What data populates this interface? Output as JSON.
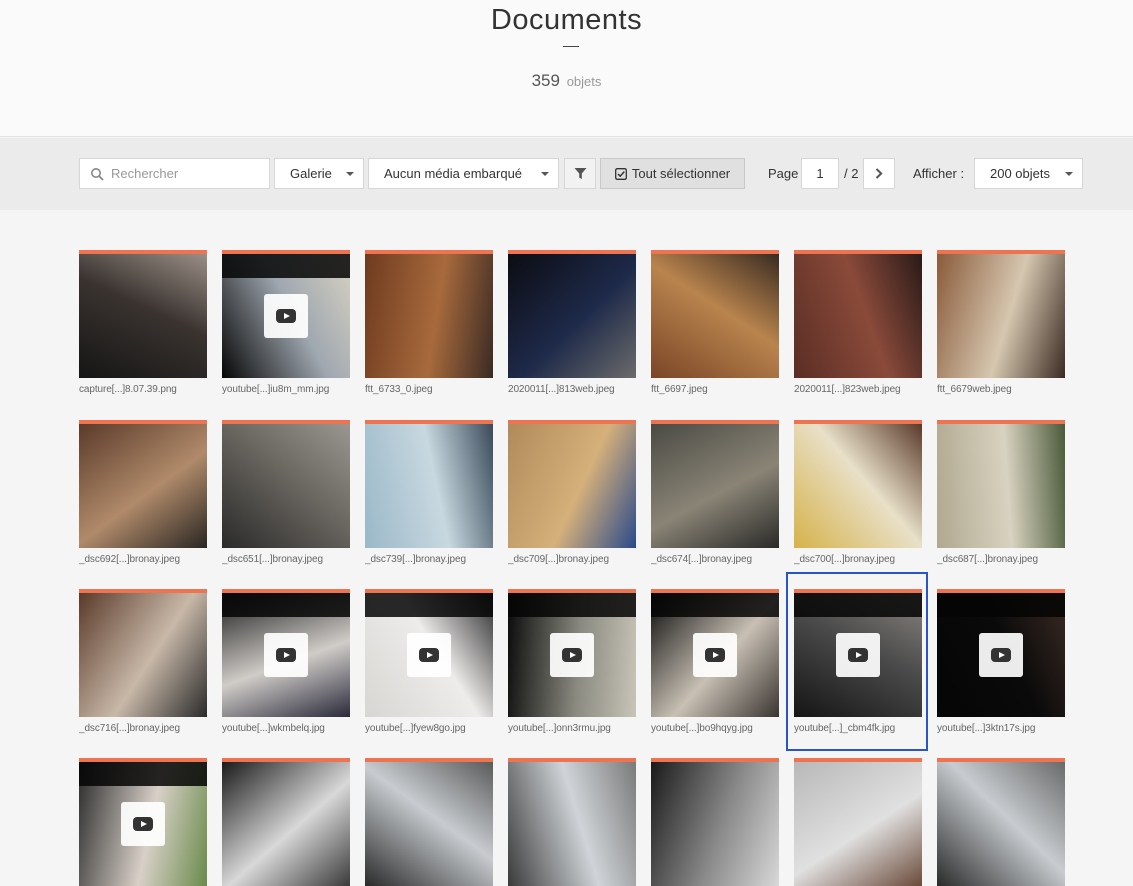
{
  "header": {
    "title": "Documents",
    "count": "359",
    "count_unit": "objets"
  },
  "toolbar": {
    "search_placeholder": "Rechercher",
    "view_mode": "Galerie",
    "media_filter": "Aucun média embarqué",
    "select_all": "Tout sélectionner",
    "page_label": "Page",
    "page_current": "1",
    "page_total": "/ 2",
    "afficher_label": "Afficher :",
    "per_page": "200 objets"
  },
  "tiles": [
    {
      "name": "capture[...]8.07.39.png",
      "video": false,
      "colors": [
        "#151515",
        "#3a3330",
        "#9a8f86"
      ]
    },
    {
      "name": "youtube[...]iu8m_mm.jpg",
      "video": true,
      "colors": [
        "#050505",
        "#9fa7b0",
        "#d8d2c2"
      ]
    },
    {
      "name": "ftt_6733_0.jpeg",
      "video": false,
      "colors": [
        "#6e3a1f",
        "#a86a3c",
        "#3b2a24"
      ]
    },
    {
      "name": "2020011[...]813web.jpeg",
      "video": false,
      "colors": [
        "#0c0c12",
        "#1e2a4a",
        "#6b6b6b"
      ]
    },
    {
      "name": "ftt_6697.jpeg",
      "video": false,
      "colors": [
        "#7a4526",
        "#b9844d",
        "#3a2b22"
      ]
    },
    {
      "name": "2020011[...]823web.jpeg",
      "video": false,
      "colors": [
        "#5a2d24",
        "#8a4a3a",
        "#2a1a18"
      ]
    },
    {
      "name": "ftt_6679web.jpeg",
      "video": false,
      "colors": [
        "#8a5a3a",
        "#d6c7b0",
        "#3a2a22"
      ]
    },
    {
      "name": "_dsc692[...]bronay.jpeg",
      "video": false,
      "colors": [
        "#5a3a2a",
        "#b08a6a",
        "#2a2622"
      ]
    },
    {
      "name": "_dsc651[...]bronay.jpeg",
      "video": false,
      "colors": [
        "#2a2a2a",
        "#6a6660",
        "#9a9690"
      ]
    },
    {
      "name": "_dsc739[...]bronay.jpeg",
      "video": false,
      "colors": [
        "#9ab8c8",
        "#c8d8e0",
        "#3a4a5a"
      ]
    },
    {
      "name": "_dsc709[...]bronay.jpeg",
      "video": false,
      "colors": [
        "#b08a5a",
        "#d6b07a",
        "#2a4a8a"
      ]
    },
    {
      "name": "_dsc674[...]bronay.jpeg",
      "video": false,
      "colors": [
        "#4a4a44",
        "#8a8476",
        "#2a2a28"
      ]
    },
    {
      "name": "_dsc700[...]bronay.jpeg",
      "video": false,
      "colors": [
        "#d6b24a",
        "#e8e0c8",
        "#5a3a2a"
      ]
    },
    {
      "name": "_dsc687[...]bronay.jpeg",
      "video": false,
      "colors": [
        "#b0a890",
        "#d8d2c0",
        "#4a5a3a"
      ]
    },
    {
      "name": "_dsc716[...]bronay.jpeg",
      "video": false,
      "colors": [
        "#5a3a2a",
        "#c8b8a8",
        "#2a2a2a"
      ]
    },
    {
      "name": "youtube[...]wkmbelq.jpg",
      "video": true,
      "colors": [
        "#1a1a1a",
        "#d0ccc8",
        "#2a2a3a"
      ]
    },
    {
      "name": "youtube[...]fyew8go.jpg",
      "video": true,
      "colors": [
        "#d8d6d2",
        "#eeeceb",
        "#2a2a2a"
      ]
    },
    {
      "name": "youtube[...]onn3rmu.jpg",
      "video": true,
      "colors": [
        "#0a0a0a",
        "#8a8a80",
        "#c8c4b8"
      ]
    },
    {
      "name": "youtube[...]bo9hqyg.jpg",
      "video": true,
      "colors": [
        "#0a0a0a",
        "#c8c0b4",
        "#3a3430"
      ]
    },
    {
      "name": "youtube[...]_cbm4fk.jpg",
      "video": true,
      "colors": [
        "#151515",
        "#4a4a4a",
        "#8a8480"
      ]
    },
    {
      "name": "youtube[...]3ktn17s.jpg",
      "video": true,
      "colors": [
        "#050505",
        "#0a0a0a",
        "#3a2a24"
      ]
    },
    {
      "name": "",
      "video": true,
      "colors": [
        "#2a2a2a",
        "#d8d0c8",
        "#6a8a4a"
      ]
    },
    {
      "name": "",
      "video": false,
      "colors": [
        "#1a1a1a",
        "#d8d8d8",
        "#3a3a3a"
      ]
    },
    {
      "name": "",
      "video": false,
      "colors": [
        "#2a2a2a",
        "#c8ccd0",
        "#5a5a5a"
      ]
    },
    {
      "name": "",
      "video": false,
      "colors": [
        "#3a3a3a",
        "#d0d4d8",
        "#7a7a7a"
      ]
    },
    {
      "name": "",
      "video": false,
      "colors": [
        "#1a1a1a",
        "#8a8a8a",
        "#d8d8d8"
      ]
    },
    {
      "name": "",
      "video": false,
      "colors": [
        "#b8b8b8",
        "#e0e0e0",
        "#6a4a3a"
      ]
    },
    {
      "name": "",
      "video": false,
      "colors": [
        "#2a2a2a",
        "#c8ccd0",
        "#6a6a6a"
      ]
    }
  ],
  "selected_tile": "youtube[...]_cbm4fk.jpg"
}
